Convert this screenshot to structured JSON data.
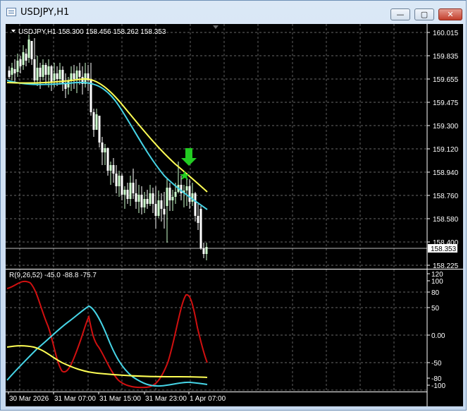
{
  "window": {
    "title": "USDJPY,H1",
    "minimize_glyph": "—",
    "maximize_glyph": "▢",
    "close_glyph": "✕"
  },
  "chart": {
    "info": "USDJPY,H1  158.300 158.456 158.262 158.353",
    "current_price_label": "158.353",
    "price_ticks": [
      "160.015",
      "159.835",
      "159.655",
      "159.475",
      "159.300",
      "159.120",
      "158.940",
      "158.760",
      "158.580",
      "158.400",
      "158.225"
    ],
    "indicator_label": "R(9,26,52) -45.0 -88.8 -75.7",
    "indicator_ticks": [
      "120",
      "100",
      "80",
      "50",
      "0.00",
      "-50",
      "-80",
      "-100"
    ],
    "time_labels": [
      "30 Mar 2026",
      "31 Mar 07:00",
      "31 Mar 15:00",
      "31 Mar 23:00",
      "1 Apr 07:00"
    ],
    "colors": {
      "background": "#000000",
      "grid": "#8a8a8a",
      "bull_candle": "#ccffcc",
      "bear_candle": "#ffffff",
      "ma_fast": "#46d4e6",
      "ma_slow": "#ffff55",
      "rsi_fast": "#d01010",
      "rsi_mid": "#46d4e6",
      "rsi_slow": "#ffff55",
      "signal_arrow": "#22cc22",
      "signal_star": "#22cc22"
    },
    "icons": {
      "signal_arrow": "arrow-down-icon",
      "signal_star": "star-icon"
    }
  }
}
